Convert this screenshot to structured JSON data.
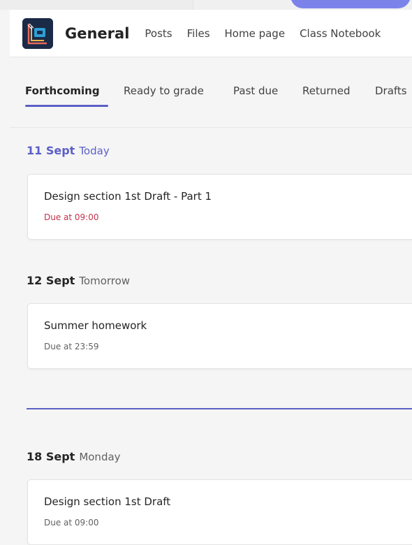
{
  "channel": {
    "team_name": "General",
    "tabs": [
      "Posts",
      "Files",
      "Home page",
      "Class Notebook"
    ]
  },
  "filters": {
    "tabs": [
      "Forthcoming",
      "Ready to grade",
      "Past due",
      "Returned",
      "Drafts"
    ],
    "active": "Forthcoming"
  },
  "groups": [
    {
      "date": "11 Sept",
      "relative": "Today",
      "assignments": [
        {
          "title": "Design section 1st Draft - Part 1",
          "due": "Due at 09:00"
        }
      ]
    },
    {
      "date": "12 Sept",
      "relative": "Tomorrow",
      "assignments": [
        {
          "title": "Summer homework",
          "due": "Due at 23:59"
        }
      ]
    },
    {
      "date": "18 Sept",
      "relative": "Monday",
      "assignments": [
        {
          "title": "Design section 1st Draft",
          "due": "Due at 09:00"
        }
      ]
    }
  ],
  "colors": {
    "accent": "#5b5fc7",
    "due_today": "#c4314b",
    "team_avatar_bg": "#1b2a47"
  },
  "icons": {
    "team_avatar": "class-team-icon"
  }
}
